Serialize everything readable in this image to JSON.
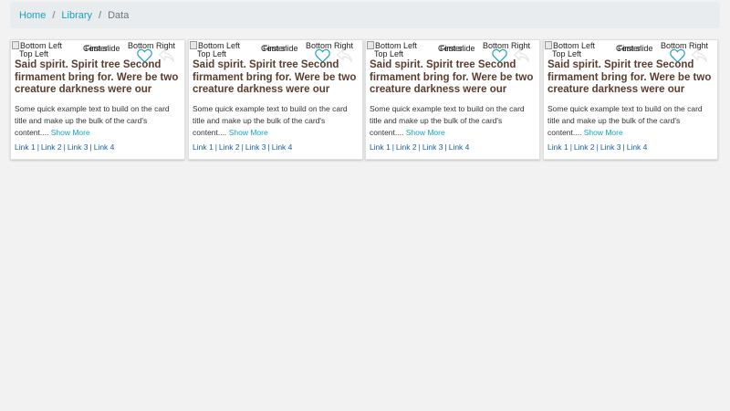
{
  "breadcrumb": {
    "items": [
      "Home",
      "Library"
    ],
    "active": "Data"
  },
  "icons": {
    "favorite": "heart-outline-icon",
    "reply": "reply-arrow-icon",
    "broken_image": "broken-image-icon"
  },
  "colors": {
    "accent": "#17a2b8",
    "title": "#5b3d2f",
    "link": "#1a5fa3"
  },
  "cards": [
    {
      "img_bottom_left": "Bottom Left",
      "img_top_left": "Top Left",
      "overlap_a": "Center",
      "overlap_b": "First slide",
      "img_bottom_right": "Bottom Right",
      "title": "Said spirit. Spirit tree Second firmament bring for. Were be two creature darkness were our fourth h",
      "text": "Some quick example text to build on the card title and make up the bulk of the card's content....",
      "show_more": "Show More",
      "links": [
        "Link 1",
        "Link 2",
        "Link 3",
        "Link 4"
      ]
    },
    {
      "img_bottom_left": "Bottom Left",
      "img_top_left": "Top Left",
      "overlap_a": "Center",
      "overlap_b": "First slide",
      "img_bottom_right": "Bottom Right",
      "title": "Said spirit. Spirit tree Second firmament bring for. Were be two creature darkness were our fourth h",
      "text": "Some quick example text to build on the card title and make up the bulk of the card's content....",
      "show_more": "Show More",
      "links": [
        "Link 1",
        "Link 2",
        "Link 3",
        "Link 4"
      ]
    },
    {
      "img_bottom_left": "Bottom Left",
      "img_top_left": "Top Left",
      "overlap_a": "Center",
      "overlap_b": "First slide",
      "img_bottom_right": "Bottom Right",
      "title": "Said spirit. Spirit tree Second firmament bring for. Were be two creature darkness were our fourth h",
      "text": "Some quick example text to build on the card title and make up the bulk of the card's content....",
      "show_more": "Show More",
      "links": [
        "Link 1",
        "Link 2",
        "Link 3",
        "Link 4"
      ]
    },
    {
      "img_bottom_left": "Bottom Left",
      "img_top_left": "Top Left",
      "overlap_a": "Center",
      "overlap_b": "First slide",
      "img_bottom_right": "Bottom Right",
      "title": "Said spirit. Spirit tree Second firmament bring for. Were be two creature darkness were our fourth h",
      "text": "Some quick example text to build on the card title and make up the bulk of the card's content....",
      "show_more": "Show More",
      "links": [
        "Link 1",
        "Link 2",
        "Link 3",
        "Link 4"
      ]
    }
  ]
}
